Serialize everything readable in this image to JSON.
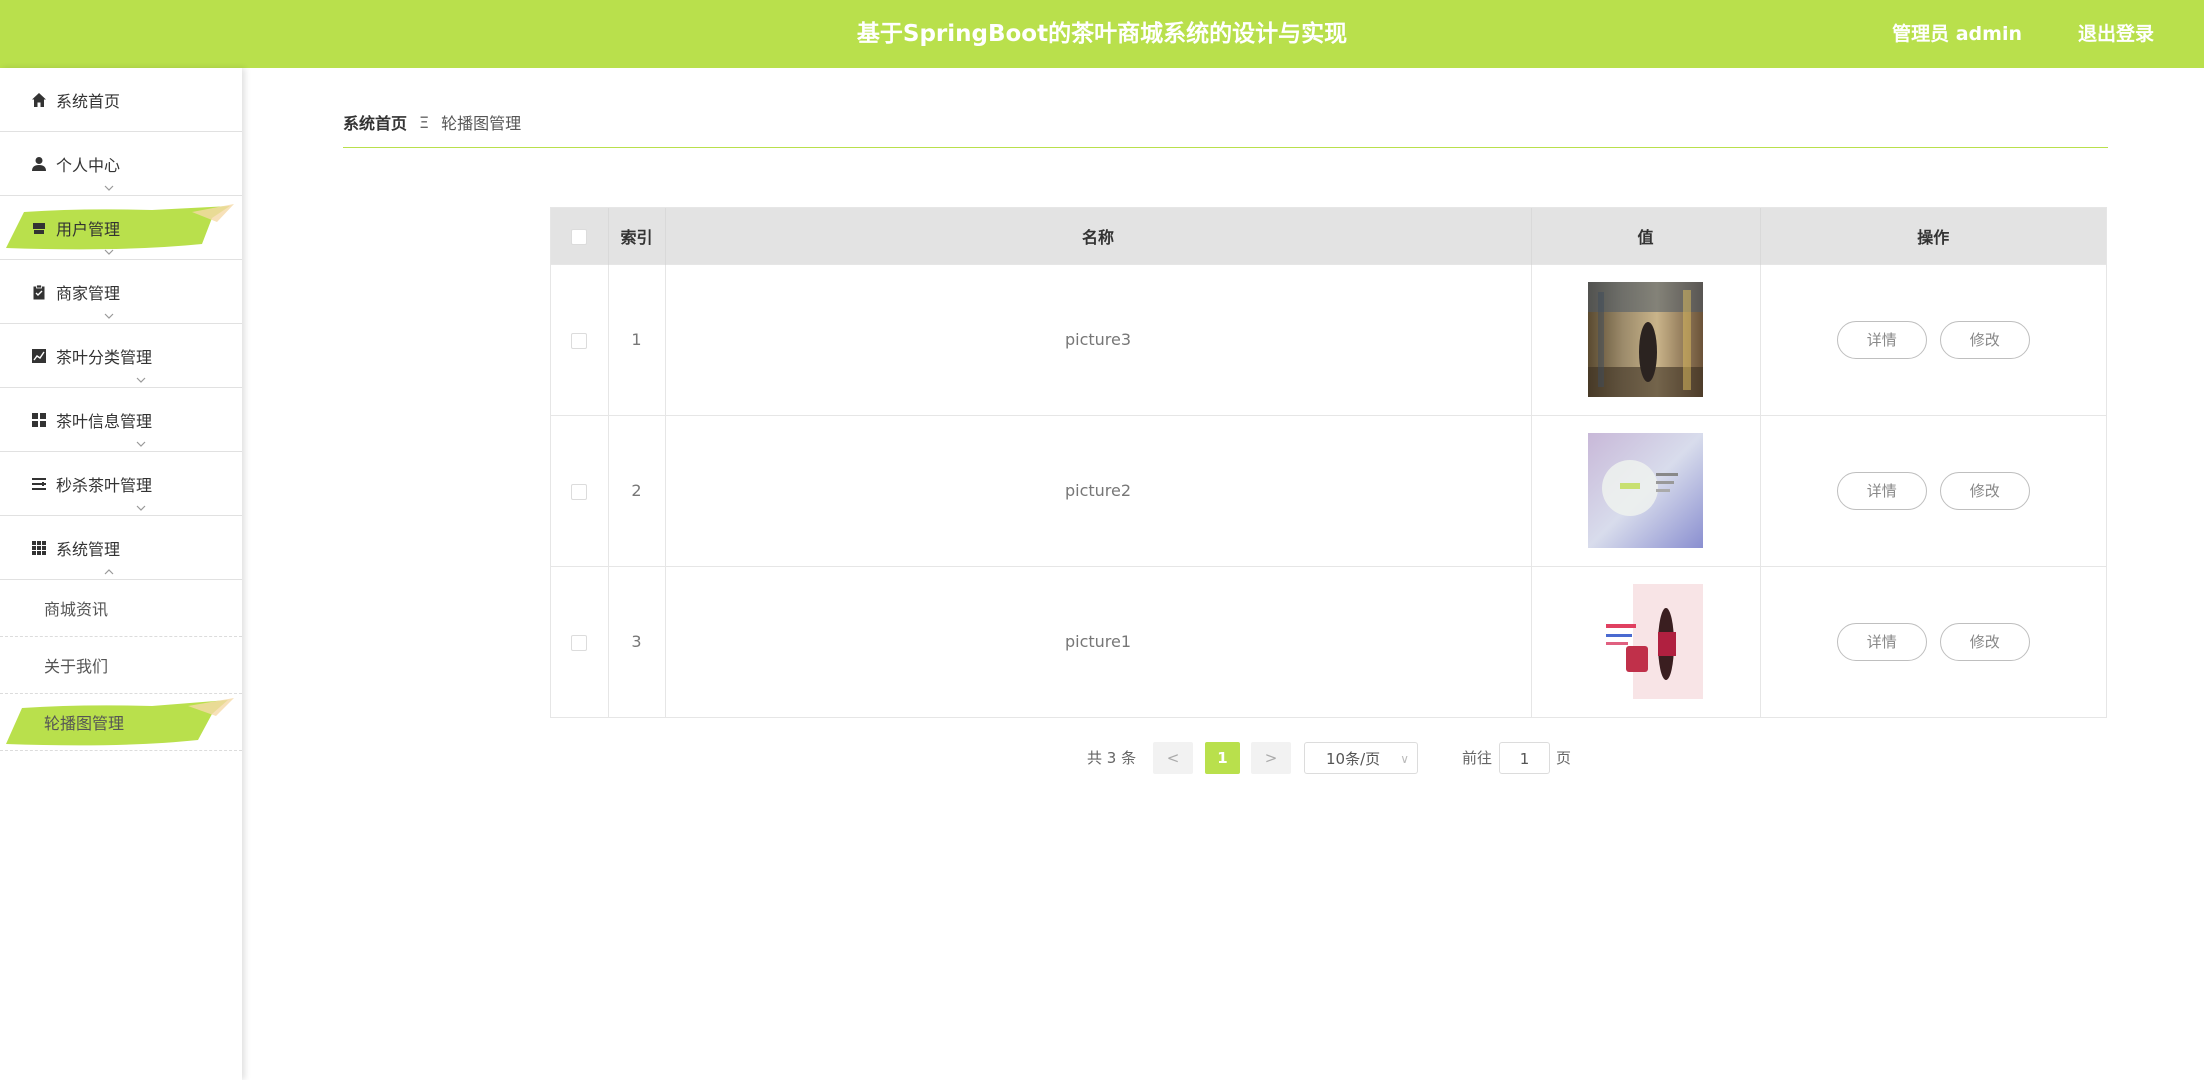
{
  "header": {
    "title": "基于SpringBoot的茶叶商城系统的设计与实现",
    "user": "管理员 admin",
    "logout": "退出登录"
  },
  "theme": {
    "accent": "#b9e04c"
  },
  "sidebar": {
    "items": [
      {
        "label": "系统首页",
        "icon": "home-icon"
      },
      {
        "label": "个人中心",
        "icon": "user-icon"
      },
      {
        "label": "用户管理",
        "icon": "store-icon"
      },
      {
        "label": "商家管理",
        "icon": "clipboard-icon"
      },
      {
        "label": "茶叶分类管理",
        "icon": "chart-icon"
      },
      {
        "label": "茶叶信息管理",
        "icon": "grid-icon"
      },
      {
        "label": "秒杀茶叶管理",
        "icon": "list-icon"
      },
      {
        "label": "系统管理",
        "icon": "apps-icon"
      }
    ],
    "subitems": [
      {
        "label": "商城资讯"
      },
      {
        "label": "关于我们"
      },
      {
        "label": "轮播图管理"
      }
    ]
  },
  "breadcrumb": {
    "home": "系统首页",
    "separator": "Ξ",
    "current": "轮播图管理"
  },
  "table": {
    "headers": {
      "index": "索引",
      "name": "名称",
      "value": "值",
      "actions": "操作"
    },
    "rows": [
      {
        "index": "1",
        "name": "picture3",
        "detail": "详情",
        "edit": "修改"
      },
      {
        "index": "2",
        "name": "picture2",
        "detail": "详情",
        "edit": "修改"
      },
      {
        "index": "3",
        "name": "picture1",
        "detail": "详情",
        "edit": "修改"
      }
    ]
  },
  "pagination": {
    "total": "共 3 条",
    "prev": "<",
    "current": "1",
    "next": ">",
    "page_size": "10条/页",
    "goto_label": "前往",
    "goto_value": "1",
    "page_suffix": "页"
  }
}
